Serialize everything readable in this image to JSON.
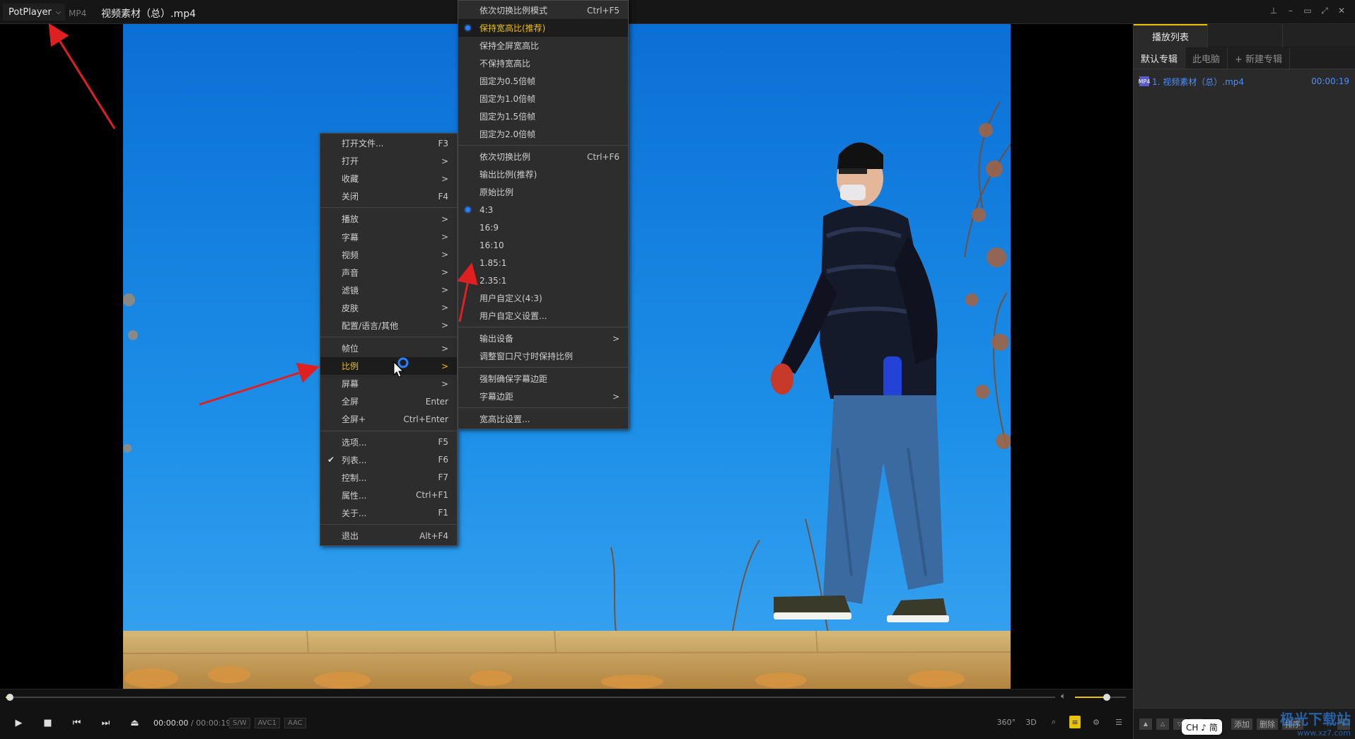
{
  "titlebar": {
    "app_button": "PotPlayer",
    "format_badge": "MP4",
    "title": "视频素材（总）.mp4"
  },
  "playlist": {
    "tab": "播放列表",
    "albums": [
      "默认专辑",
      "此电脑",
      "+ 新建专辑"
    ],
    "items": [
      {
        "name": "1. 视频素材（总）.mp4",
        "duration": "00:00:19",
        "icon": "MP4"
      }
    ],
    "bottom_buttons": [
      "添加",
      "删除",
      "排序"
    ],
    "ime": "CH ♪ 简",
    "watermark_line1": "极光下载站",
    "watermark_line2": "www.xz7.com"
  },
  "controls": {
    "time_current": "00:00:00",
    "time_total": "00:00:19",
    "tags": [
      "S/W",
      "AVC1",
      "AAC"
    ],
    "progress": 0.004,
    "volume": 0.62,
    "right_buttons": [
      "360°",
      "3D"
    ]
  },
  "main_menu": [
    {
      "label": "打开文件...",
      "shortcut": "F3"
    },
    {
      "label": "打开",
      "shortcut": ">"
    },
    {
      "label": "收藏",
      "shortcut": ">"
    },
    {
      "label": "关闭",
      "shortcut": "F4"
    },
    {
      "sep": true
    },
    {
      "label": "播放",
      "shortcut": ">"
    },
    {
      "label": "字幕",
      "shortcut": ">"
    },
    {
      "label": "视频",
      "shortcut": ">"
    },
    {
      "label": "声音",
      "shortcut": ">"
    },
    {
      "label": "滤镜",
      "shortcut": ">"
    },
    {
      "label": "皮肤",
      "shortcut": ">"
    },
    {
      "label": "配置/语言/其他",
      "shortcut": ">"
    },
    {
      "sep": true
    },
    {
      "label": "帧位",
      "shortcut": ">"
    },
    {
      "label": "比例",
      "shortcut": ">",
      "highlight": true
    },
    {
      "label": "屏幕",
      "shortcut": ">"
    },
    {
      "label": "全屏",
      "shortcut": "Enter"
    },
    {
      "label": "全屏+",
      "shortcut": "Ctrl+Enter"
    },
    {
      "sep": true
    },
    {
      "label": "选项...",
      "shortcut": "F5"
    },
    {
      "label": "列表...",
      "shortcut": "F6",
      "checked": true
    },
    {
      "label": "控制...",
      "shortcut": "F7"
    },
    {
      "label": "属性...",
      "shortcut": "Ctrl+F1"
    },
    {
      "label": "关于...",
      "shortcut": "F1"
    },
    {
      "sep": true
    },
    {
      "label": "退出",
      "shortcut": "Alt+F4"
    }
  ],
  "sub_menu": [
    {
      "label": "依次切换比例模式",
      "shortcut": "Ctrl+F5"
    },
    {
      "label": "保持宽高比(推荐)",
      "shortcut": "",
      "highlight": true,
      "selected": true
    },
    {
      "label": "保持全屏宽高比",
      "shortcut": ""
    },
    {
      "label": "不保持宽高比",
      "shortcut": ""
    },
    {
      "label": "固定为0.5倍帧",
      "shortcut": ""
    },
    {
      "label": "固定为1.0倍帧",
      "shortcut": ""
    },
    {
      "label": "固定为1.5倍帧",
      "shortcut": ""
    },
    {
      "label": "固定为2.0倍帧",
      "shortcut": ""
    },
    {
      "sep": true
    },
    {
      "label": "依次切换比例",
      "shortcut": "Ctrl+F6"
    },
    {
      "label": "输出比例(推荐)",
      "shortcut": ""
    },
    {
      "label": "原始比例",
      "shortcut": ""
    },
    {
      "label": "4:3",
      "shortcut": "",
      "selected": true
    },
    {
      "label": "16:9",
      "shortcut": ""
    },
    {
      "label": "16:10",
      "shortcut": ""
    },
    {
      "label": "1.85:1",
      "shortcut": ""
    },
    {
      "label": "2.35:1",
      "shortcut": ""
    },
    {
      "label": "用户自定义(4:3)",
      "shortcut": ""
    },
    {
      "label": "用户自定义设置...",
      "shortcut": ""
    },
    {
      "sep": true
    },
    {
      "label": "输出设备",
      "shortcut": ">"
    },
    {
      "label": "调整窗口尺寸时保持比例",
      "shortcut": ""
    },
    {
      "sep": true
    },
    {
      "label": "强制确保字幕边距",
      "shortcut": ""
    },
    {
      "label": "字幕边距",
      "shortcut": ">"
    },
    {
      "sep": true
    },
    {
      "label": "宽高比设置...",
      "shortcut": ""
    }
  ],
  "colors": {
    "accent": "#e8c400",
    "menu_highlight_text": "#f0c000",
    "sky": "#1d8fe8",
    "annotation": "#e02020",
    "playlist_link": "#4a8fff"
  }
}
